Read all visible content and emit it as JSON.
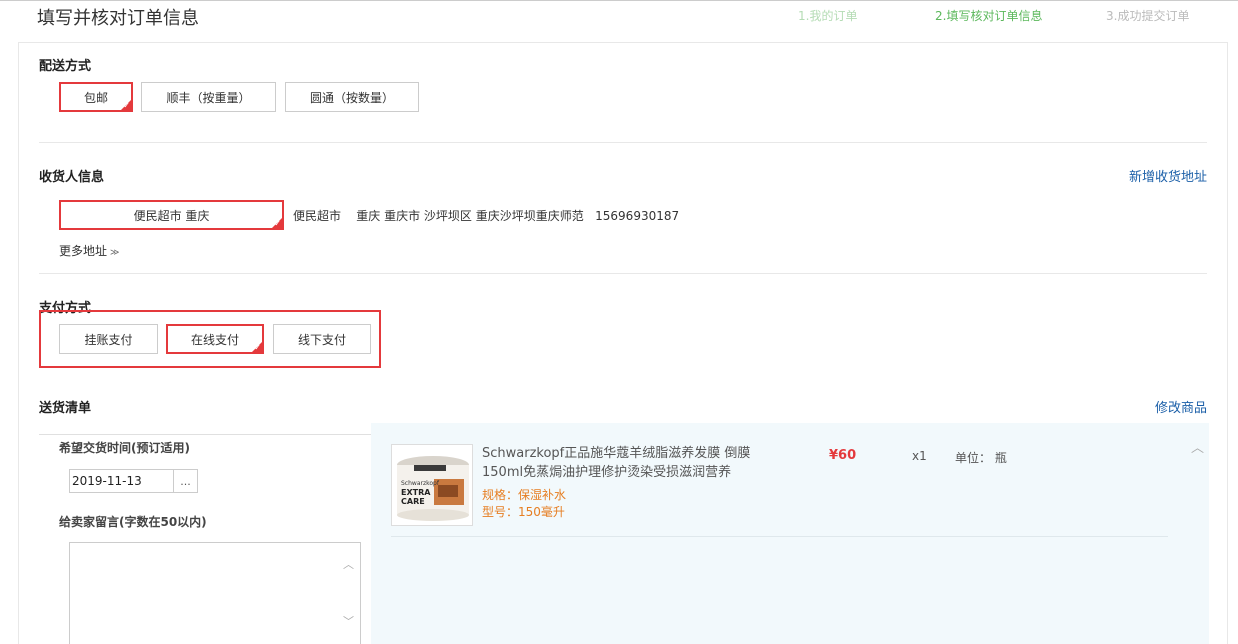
{
  "header": {
    "title": "填写并核对订单信息",
    "steps": [
      "1.我的订单",
      "2.填写核对订单信息",
      "3.成功提交订单"
    ]
  },
  "delivery": {
    "title": "配送方式",
    "options": [
      "包邮",
      "顺丰（按重量）",
      "圆通（按数量）"
    ],
    "selected": "包邮"
  },
  "receiver": {
    "title": "收货人信息",
    "add_link": "新增收货地址",
    "selected_label": "便民超市 重庆",
    "address": "便民超市    重庆 重庆市 沙坪坝区 重庆沙坪坝重庆师范   15696930187",
    "more": "更多地址"
  },
  "payment": {
    "title": "支付方式",
    "options": [
      "挂账支付",
      "在线支付",
      "线下支付"
    ],
    "selected": "在线支付"
  },
  "shipping_list": {
    "title": "送货清单",
    "edit_link": "修改商品",
    "time_label": "希望交货时间(预订适用)",
    "date_value": "2019-11-13",
    "date_btn": "...",
    "message_label": "给卖家留言(字数在50以内)"
  },
  "product": {
    "name": "Schwarzkopf正品施华蔻羊绒脂滋养发膜 倒膜150ml免蒸焗油护理修护烫染受损滋润营养",
    "spec": "规格：保湿补水",
    "model": "型号：150毫升",
    "price": "¥60",
    "qty": "x1",
    "unit": "单位： 瓶",
    "thumb_brand": "Schwarzkopf",
    "thumb_line1": "EXTRA",
    "thumb_line2": "CARE"
  },
  "colors": {
    "accent": "#e4393c",
    "link": "#1b5fa8",
    "step_active": "#5cb85c",
    "spec": "#e67e22"
  }
}
